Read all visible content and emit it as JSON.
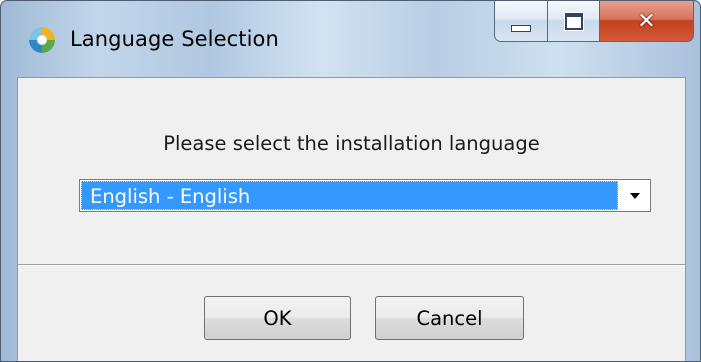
{
  "window": {
    "title": "Language Selection",
    "app_icon": "installer-swirl-icon",
    "controls": {
      "minimize": "minimize-icon",
      "maximize": "maximize-icon",
      "close": "close-icon"
    }
  },
  "dialog": {
    "prompt": "Please select the installation language",
    "language_select": {
      "selected_value": "English - English"
    },
    "buttons": {
      "ok_label": "OK",
      "cancel_label": "Cancel"
    }
  },
  "colors": {
    "selection_highlight": "#3399ff",
    "close_button": "#c4411e"
  }
}
